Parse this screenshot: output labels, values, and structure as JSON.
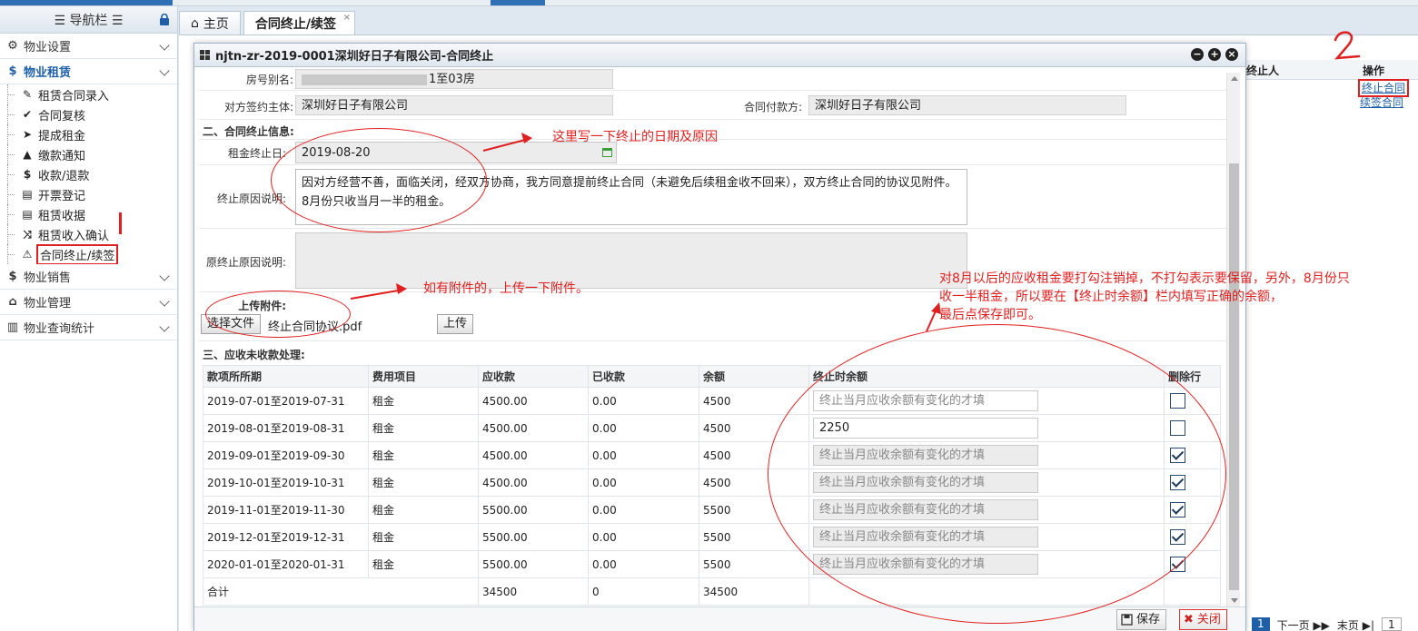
{
  "nav": {
    "title": "☰ 导航栏 ☰",
    "groups": [
      {
        "icon": "⚙",
        "label": "物业设置"
      },
      {
        "icon": "$",
        "label": "物业租赁"
      },
      {
        "icon": "$",
        "label": "物业销售"
      },
      {
        "icon": "⌂",
        "label": "物业管理"
      },
      {
        "icon": "▥",
        "label": "物业查询统计"
      }
    ],
    "sub_items": [
      {
        "icon": "✎",
        "label": "租赁合同录入"
      },
      {
        "icon": "✔",
        "label": "合同复核"
      },
      {
        "icon": "➤",
        "label": "提成租金"
      },
      {
        "icon": "▲",
        "label": "缴款通知"
      },
      {
        "icon": "$",
        "label": "收款/退款"
      },
      {
        "icon": "▤",
        "label": "开票登记"
      },
      {
        "icon": "▤",
        "label": "租赁收据"
      },
      {
        "icon": "⤨",
        "label": "租赁收入确认"
      },
      {
        "icon": "⚠",
        "label": "合同终止/续签"
      }
    ]
  },
  "tabs": [
    {
      "label": "主页"
    },
    {
      "label": "合同终止/续签",
      "close": "×"
    }
  ],
  "grid": {
    "col_terminator": "终止人",
    "col_op": "操作",
    "op_terminate": "终止合同",
    "op_renew": "续签合同"
  },
  "pager": {
    "current": "1",
    "next": "下一页 ▶▶",
    "last": "末页 ▶|",
    "page_input": "1"
  },
  "modal": {
    "title": "njtn-zr-2019-0001深圳好日子有限公司-合同终止",
    "room_alias_label": "房号别名:",
    "room_alias_value": "1至03房",
    "counterparty_label": "对方签约主体:",
    "counterparty_value": "深圳好日子有限公司",
    "payer_label": "合同付款方:",
    "payer_value": "深圳好日子有限公司",
    "section2": "二、合同终止信息:",
    "rent_end_label": "租金终止日:",
    "rent_end_value": "2019-08-20",
    "reason_label": "终止原因说明:",
    "reason_value": "因对方经营不善，面临关闭，经双方协商，我方同意提前终止合同（未避免后续租金收不回来），双方终止合同的协议见附件。8月份只收当月一半的租金。",
    "orig_reason_label": "原终止原因说明:",
    "upload_label": "上传附件:",
    "choose_file": "选择文件",
    "file_name": "终止合同协议.pdf",
    "upload_btn": "上传",
    "section3": "三、应收未收款处理:",
    "table_headers": [
      "款项所所期",
      "费用项目",
      "应收款",
      "已收款",
      "余额",
      "终止时余额",
      "删除行"
    ],
    "placeholder": "终止当月应收余额有变化的才填",
    "rows": [
      {
        "period": "2019-07-01至2019-07-31",
        "item": "租金",
        "due": "4500.00",
        "paid": "0.00",
        "balance": "4500",
        "end_value": "",
        "editable": true,
        "checked": false
      },
      {
        "period": "2019-08-01至2019-08-31",
        "item": "租金",
        "due": "4500.00",
        "paid": "0.00",
        "balance": "4500",
        "end_value": "2250",
        "editable": true,
        "checked": false
      },
      {
        "period": "2019-09-01至2019-09-30",
        "item": "租金",
        "due": "4500.00",
        "paid": "0.00",
        "balance": "4500",
        "end_value": "",
        "editable": false,
        "checked": true
      },
      {
        "period": "2019-10-01至2019-10-31",
        "item": "租金",
        "due": "4500.00",
        "paid": "0.00",
        "balance": "4500",
        "end_value": "",
        "editable": false,
        "checked": true
      },
      {
        "period": "2019-11-01至2019-11-30",
        "item": "租金",
        "due": "5500.00",
        "paid": "0.00",
        "balance": "5500",
        "end_value": "",
        "editable": false,
        "checked": true
      },
      {
        "period": "2019-12-01至2019-12-31",
        "item": "租金",
        "due": "5500.00",
        "paid": "0.00",
        "balance": "5500",
        "end_value": "",
        "editable": false,
        "checked": true
      },
      {
        "period": "2020-01-01至2020-01-31",
        "item": "租金",
        "due": "5500.00",
        "paid": "0.00",
        "balance": "5500",
        "end_value": "",
        "editable": false,
        "checked": true
      }
    ],
    "total": {
      "label": "合计",
      "due": "34500",
      "paid": "0",
      "balance": "34500"
    },
    "save": "保存",
    "close": "关闭"
  },
  "annotations": {
    "a1": "这里写一下终止的日期及原因",
    "a2": "如有附件的，上传一下附件。",
    "a3_line1": "对8月以后的应收租金要打勾注销掉，不打勾表示要保留，另外，8月份只",
    "a3_line2": "收一半租金，所以要在【终止时余额】栏内填写正确的余额，",
    "a3_line3": "最后点保存即可。"
  },
  "colors": {
    "accent": "#1f5fa8",
    "annotation": "#e02020"
  }
}
